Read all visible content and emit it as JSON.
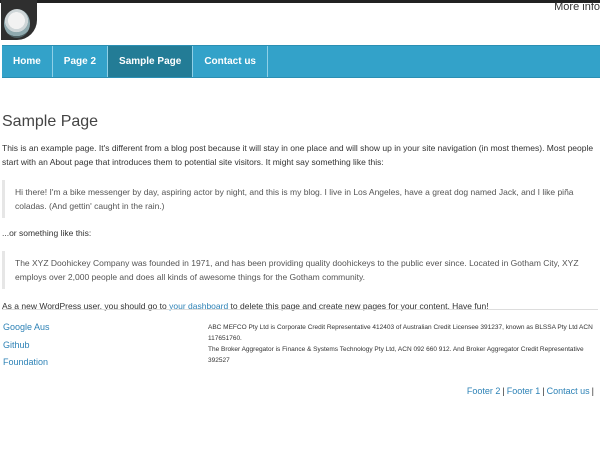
{
  "header": {
    "more_info": "More info"
  },
  "nav": {
    "items": [
      {
        "label": "Home"
      },
      {
        "label": "Page 2"
      },
      {
        "label": "Sample Page"
      },
      {
        "label": "Contact us"
      }
    ]
  },
  "page": {
    "title": "Sample Page",
    "intro": "This is an example page. It's different from a blog post because it will stay in one place and will show up in your site navigation (in most themes). Most people start with an About page that introduces them to potential site visitors. It might say something like this:",
    "quote1": "Hi there! I'm a bike messenger by day, aspiring actor by night, and this is my blog. I live in Los Angeles, have a great dog named Jack, and I like piña coladas. (And gettin' caught in the rain.)",
    "or_text": "...or something like this:",
    "quote2": "The XYZ Doohickey Company was founded in 1971, and has been providing quality doohickeys to the public ever since. Located in Gotham City, XYZ employs over 2,000 people and does all kinds of awesome things for the Gotham community.",
    "final_before": "As a new WordPress user, you should go to ",
    "final_link": "your dashboard",
    "final_after": " to delete this page and create new pages for your content. Have fun!"
  },
  "footer": {
    "links": [
      "Google Aus",
      "Github",
      "Foundation"
    ],
    "text1": "ABC MEFCO Pty Ltd is Corporate Credit Representative 412403 of Australian Credit Licensee 391237, known as BLSSA Pty Ltd ACN 117651760.",
    "text2": "The Broker Aggregator is Finance & Systems Technology Pty Ltd, ACN 092 660 912. And Broker Aggregator Credit Representative 392527",
    "bottom_links": [
      "Footer 2",
      "Footer 1",
      "Contact us"
    ],
    "separator": "|"
  },
  "colors": {
    "nav_bg": "#33a2c9",
    "nav_active": "#237c96",
    "link": "#2d82b6"
  }
}
